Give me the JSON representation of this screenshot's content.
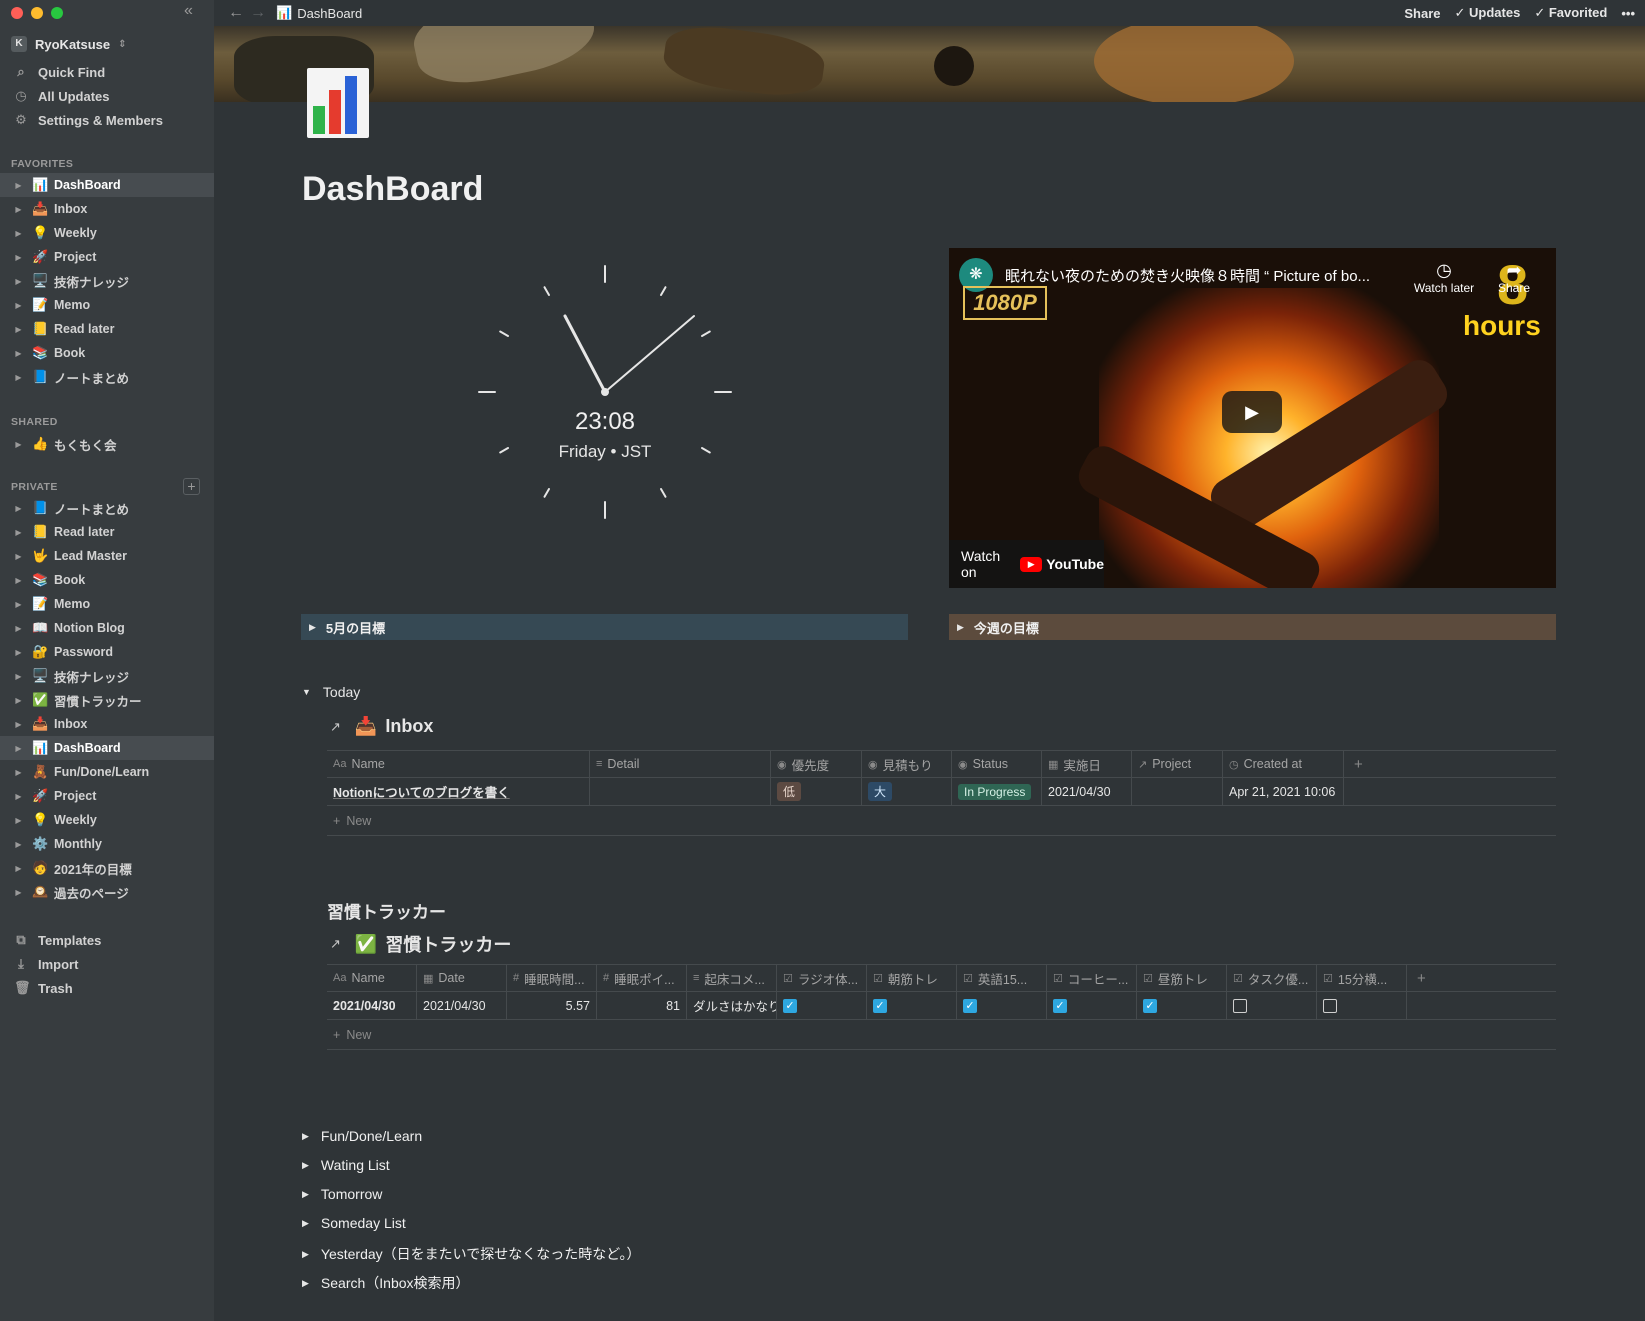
{
  "sidebar": {
    "workspace": {
      "avatar": "K",
      "name": "RyoKatsuse"
    },
    "nav": [
      {
        "icon": "search-icon",
        "glyph": "⌕",
        "label": "Quick Find"
      },
      {
        "icon": "clock-icon",
        "glyph": "◷",
        "label": "All Updates"
      },
      {
        "icon": "gear-icon",
        "glyph": "⚙",
        "label": "Settings & Members"
      }
    ],
    "favorites_label": "FAVORITES",
    "favorites": [
      {
        "emoji": "📊",
        "label": "DashBoard",
        "active": true
      },
      {
        "emoji": "📥",
        "label": "Inbox"
      },
      {
        "emoji": "💡",
        "label": "Weekly"
      },
      {
        "emoji": "🚀",
        "label": "Project"
      },
      {
        "emoji": "🖥️",
        "label": "技術ナレッジ"
      },
      {
        "emoji": "📝",
        "label": "Memo"
      },
      {
        "emoji": "📒",
        "label": "Read later"
      },
      {
        "emoji": "📚",
        "label": "Book"
      },
      {
        "emoji": "📘",
        "label": "ノートまとめ"
      }
    ],
    "shared_label": "SHARED",
    "shared": [
      {
        "emoji": "👍",
        "label": "もくもく会"
      }
    ],
    "private_label": "PRIVATE",
    "private": [
      {
        "emoji": "📘",
        "label": "ノートまとめ"
      },
      {
        "emoji": "📒",
        "label": "Read later"
      },
      {
        "emoji": "🤟",
        "label": "Lead Master"
      },
      {
        "emoji": "📚",
        "label": "Book"
      },
      {
        "emoji": "📝",
        "label": "Memo"
      },
      {
        "emoji": "📖",
        "label": "Notion Blog"
      },
      {
        "emoji": "🔐",
        "label": "Password"
      },
      {
        "emoji": "🖥️",
        "label": "技術ナレッジ"
      },
      {
        "emoji": "✅",
        "label": "習慣トラッカー"
      },
      {
        "emoji": "📥",
        "label": "Inbox"
      },
      {
        "emoji": "📊",
        "label": "DashBoard",
        "active": true
      },
      {
        "emoji": "🧸",
        "label": "Fun/Done/Learn"
      },
      {
        "emoji": "🚀",
        "label": "Project"
      },
      {
        "emoji": "💡",
        "label": "Weekly"
      },
      {
        "emoji": "⚙️",
        "label": "Monthly"
      },
      {
        "emoji": "🧑",
        "label": "2021年の目標"
      },
      {
        "emoji": "🕰️",
        "label": "過去のページ"
      }
    ],
    "bottom": [
      {
        "icon": "templates-icon",
        "glyph": "⧉",
        "label": "Templates"
      },
      {
        "icon": "import-icon",
        "glyph": "⤓",
        "label": "Import"
      },
      {
        "icon": "trash-icon",
        "glyph": "🗑",
        "label": "Trash"
      }
    ]
  },
  "topbar": {
    "breadcrumb": {
      "emoji": "📊",
      "label": "DashBoard"
    },
    "share": "Share",
    "updates": "Updates",
    "favorited": "Favorited",
    "more": "•••"
  },
  "page": {
    "title": "DashBoard",
    "icon": "bar-chart-icon"
  },
  "clock": {
    "time": "23:08",
    "sub": "Friday • JST"
  },
  "video": {
    "channel_glyph": "❋",
    "title": "眠れない夜のための焚き火映像８時間 “ Picture of bo...",
    "badge": "1080P",
    "watch_later": "Watch later",
    "share": "Share",
    "big_number": "8",
    "hours": "hours",
    "watch_on": "Watch on",
    "youtube": "YouTube"
  },
  "toggles": {
    "may_goal": "5月の目標",
    "week_goal": "今週の目標",
    "today": "Today"
  },
  "inbox": {
    "title": "Inbox",
    "emoji": "📥",
    "columns": [
      {
        "icon": "Aa",
        "label": "Name"
      },
      {
        "icon": "≡",
        "label": "Detail"
      },
      {
        "icon": "◉",
        "label": "優先度"
      },
      {
        "icon": "◉",
        "label": "見積もり"
      },
      {
        "icon": "◉",
        "label": "Status"
      },
      {
        "icon": "▦",
        "label": "実施日"
      },
      {
        "icon": "↗",
        "label": "Project"
      },
      {
        "icon": "◷",
        "label": "Created at"
      }
    ],
    "row": {
      "name": "Notionについてのブログを書く",
      "detail": "",
      "priority": "低",
      "estimate": "大",
      "status": "In Progress",
      "date": "2021/04/30",
      "project": "",
      "created": "Apr 21, 2021 10:06"
    },
    "new_label": "New"
  },
  "habit": {
    "heading": "習慣トラッカー",
    "title": "習慣トラッカー",
    "emoji": "✅",
    "columns": [
      {
        "icon": "Aa",
        "label": "Name"
      },
      {
        "icon": "▦",
        "label": "Date"
      },
      {
        "icon": "#",
        "label": "睡眠時間..."
      },
      {
        "icon": "#",
        "label": "睡眠ポイ..."
      },
      {
        "icon": "≡",
        "label": "起床コメ..."
      },
      {
        "icon": "☑",
        "label": "ラジオ体..."
      },
      {
        "icon": "☑",
        "label": "朝筋トレ"
      },
      {
        "icon": "☑",
        "label": "英語15..."
      },
      {
        "icon": "☑",
        "label": "コーヒー..."
      },
      {
        "icon": "☑",
        "label": "昼筋トレ"
      },
      {
        "icon": "☑",
        "label": "タスク優..."
      },
      {
        "icon": "☑",
        "label": "15分横..."
      }
    ],
    "row": {
      "name": "2021/04/30",
      "date": "2021/04/30",
      "sleep_hours": "5.57",
      "sleep_points": "81",
      "wake_comment": "ダルさはかなりあ"
    },
    "checks": [
      true,
      true,
      true,
      true,
      true,
      false,
      false
    ],
    "new_label": "New"
  },
  "lower_toggles": [
    "Fun/Done/Learn",
    "Wating List",
    "Tomorrow",
    "Someday List",
    "Yesterday（日をまたいで探せなくなった時など。）",
    "Search（Inbox検索用）"
  ]
}
